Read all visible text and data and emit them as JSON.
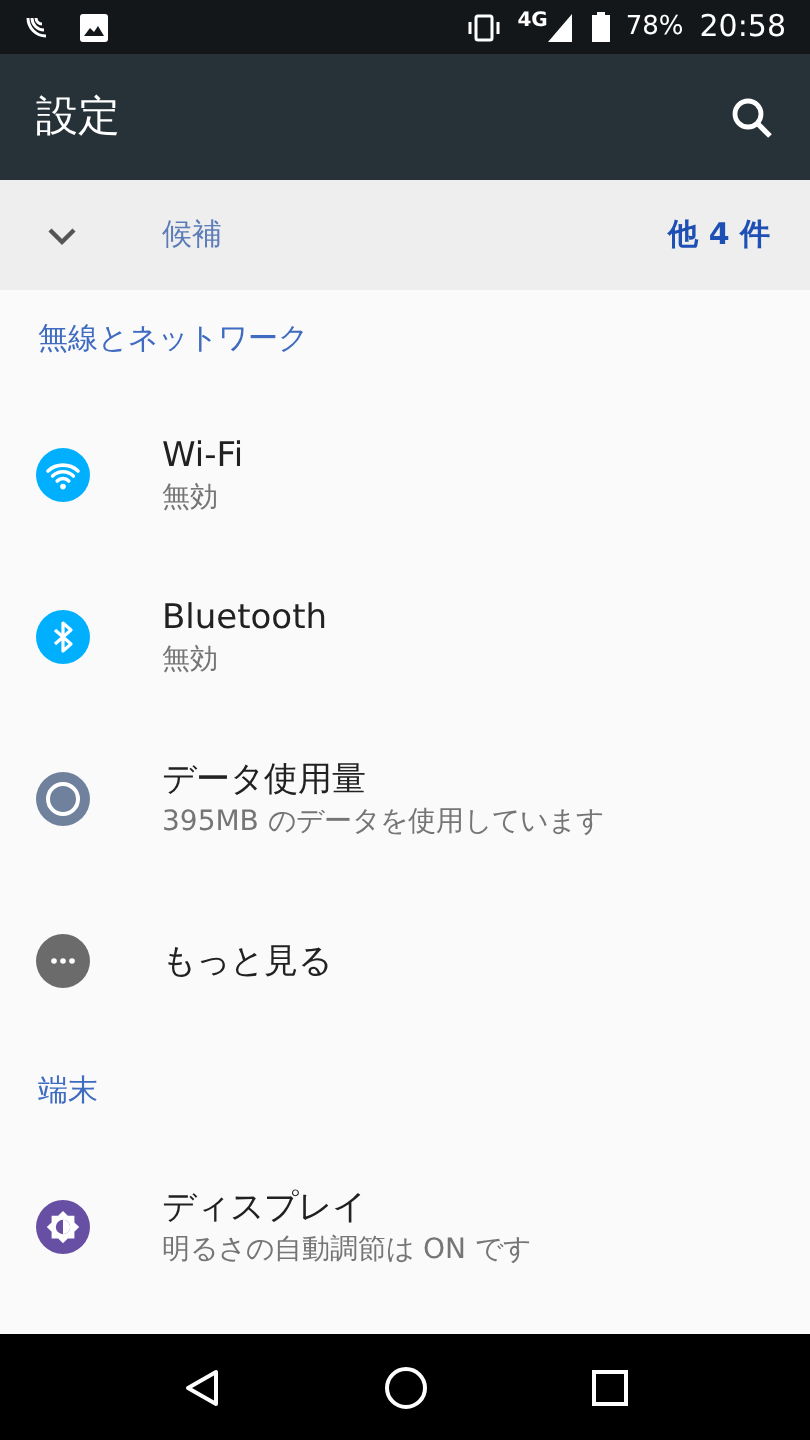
{
  "status_bar": {
    "network_type": "4G",
    "battery": "78%",
    "time": "20:58"
  },
  "app_bar": {
    "title": "設定"
  },
  "suggestions": {
    "label": "候補",
    "count": "他 4 件",
    "expanded": false
  },
  "sections": [
    {
      "title": "無線とネットワーク",
      "items": [
        {
          "title": "Wi-Fi",
          "summary": "無効"
        },
        {
          "title": "Bluetooth",
          "summary": "無効"
        },
        {
          "title": "データ使用量",
          "summary": "395MB のデータを使用しています"
        },
        {
          "title": "もっと見る"
        }
      ]
    },
    {
      "title": "端末",
      "items": [
        {
          "title": "ディスプレイ",
          "summary": "明るさの自動調節は ON です"
        }
      ]
    }
  ]
}
